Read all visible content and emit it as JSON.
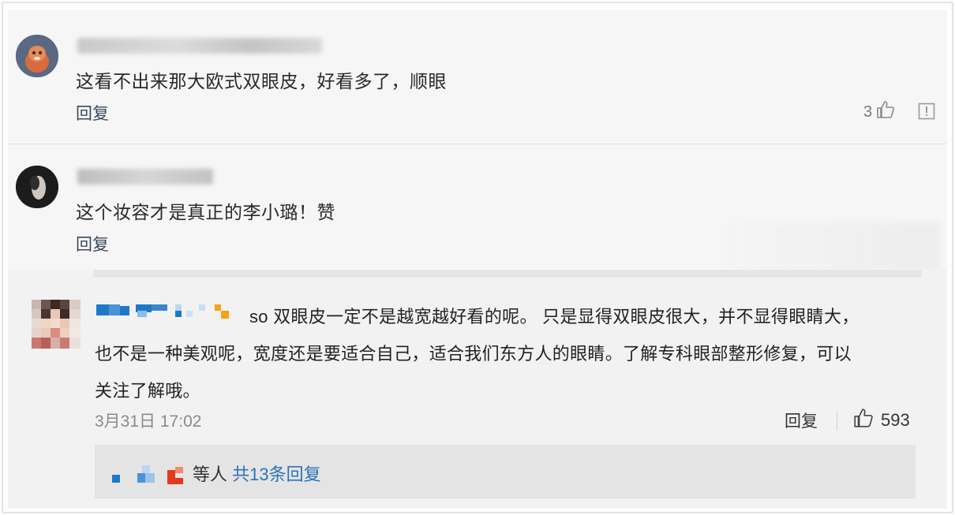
{
  "comments": [
    {
      "text": "这看不出来那大欧式双眼皮，好看多了，顺眼",
      "reply_label": "回复",
      "likes": "3"
    },
    {
      "text": "这个妆容才是真正的李小璐！赞",
      "reply_label": "回复"
    }
  ],
  "main_comment": {
    "line1_prefix": "so 双眼皮一定不是越宽越好看的呢。 只是显得双眼皮很大，并不显得眼睛大，",
    "line2": "也不是一种美观呢，宽度还是要适合自己，适合我们东方人的眼睛。了解专科眼部整形修复，可以",
    "line3": "关注了解哦。",
    "timestamp": "3月31日 17:02",
    "reply_label": "回复",
    "likes": "593",
    "sub_prefix": "等人",
    "sub_link": "共13条回复"
  },
  "colors": {
    "link_blue": "#2b73b8",
    "pixel_blue": "#1e78c8",
    "pixel_orange": "#f2a516",
    "pixel_red": "#e23a1e"
  },
  "icons": [
    "thumbs-up-icon",
    "report-icon",
    "avatar-icon"
  ]
}
